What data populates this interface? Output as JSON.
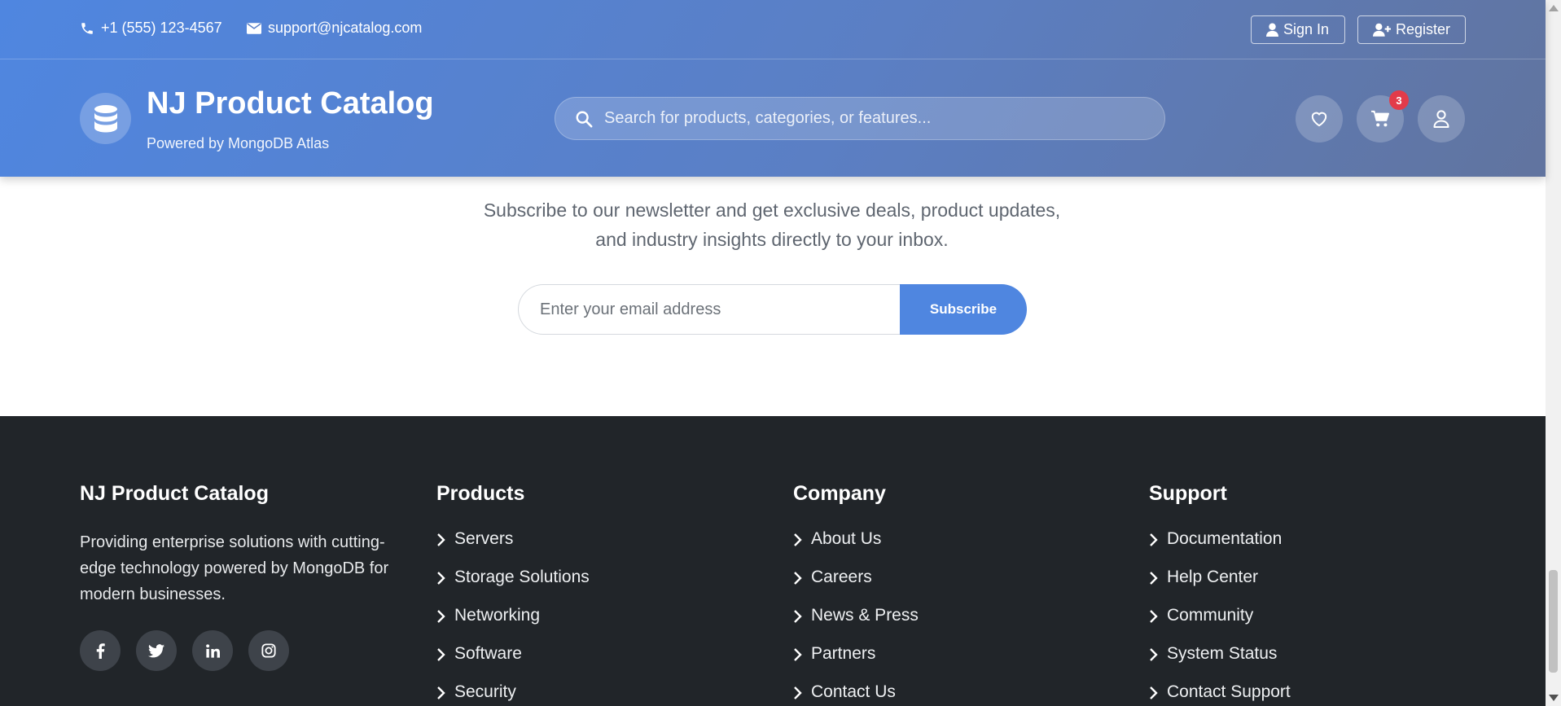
{
  "topbar": {
    "phone": "+1 (555) 123-4567",
    "email": "support@njcatalog.com",
    "signin_label": "Sign In",
    "register_label": "Register"
  },
  "brand": {
    "title": "NJ Product Catalog",
    "subtitle": "Powered by MongoDB Atlas"
  },
  "search": {
    "placeholder": "Search for products, categories, or features..."
  },
  "actions": {
    "icons": [
      "heart-icon",
      "cart-icon",
      "user-icon"
    ],
    "cart_count": "3"
  },
  "newsletter": {
    "text_line1": "Subscribe to our newsletter and get exclusive deals, product updates,",
    "text_line2": "and industry insights directly to your inbox.",
    "email_placeholder": "Enter your email address",
    "button_label": "Subscribe"
  },
  "footer": {
    "about": {
      "title": "NJ Product Catalog",
      "text": "Providing enterprise solutions with cutting-edge technology powered by MongoDB for modern businesses.",
      "socials": [
        "facebook-icon",
        "twitter-icon",
        "linkedin-icon",
        "instagram-icon"
      ]
    },
    "products": {
      "title": "Products",
      "links": [
        "Servers",
        "Storage Solutions",
        "Networking",
        "Software",
        "Security"
      ]
    },
    "company": {
      "title": "Company",
      "links": [
        "About Us",
        "Careers",
        "News & Press",
        "Partners",
        "Contact Us"
      ]
    },
    "support": {
      "title": "Support",
      "links": [
        "Documentation",
        "Help Center",
        "Community",
        "System Status",
        "Contact Support"
      ]
    }
  },
  "colors": {
    "header_gradient_start": "#4f86e0",
    "header_gradient_end": "#61749f",
    "accent": "#4f86e0",
    "badge": "#e23b4a",
    "footer_bg": "#212529"
  }
}
